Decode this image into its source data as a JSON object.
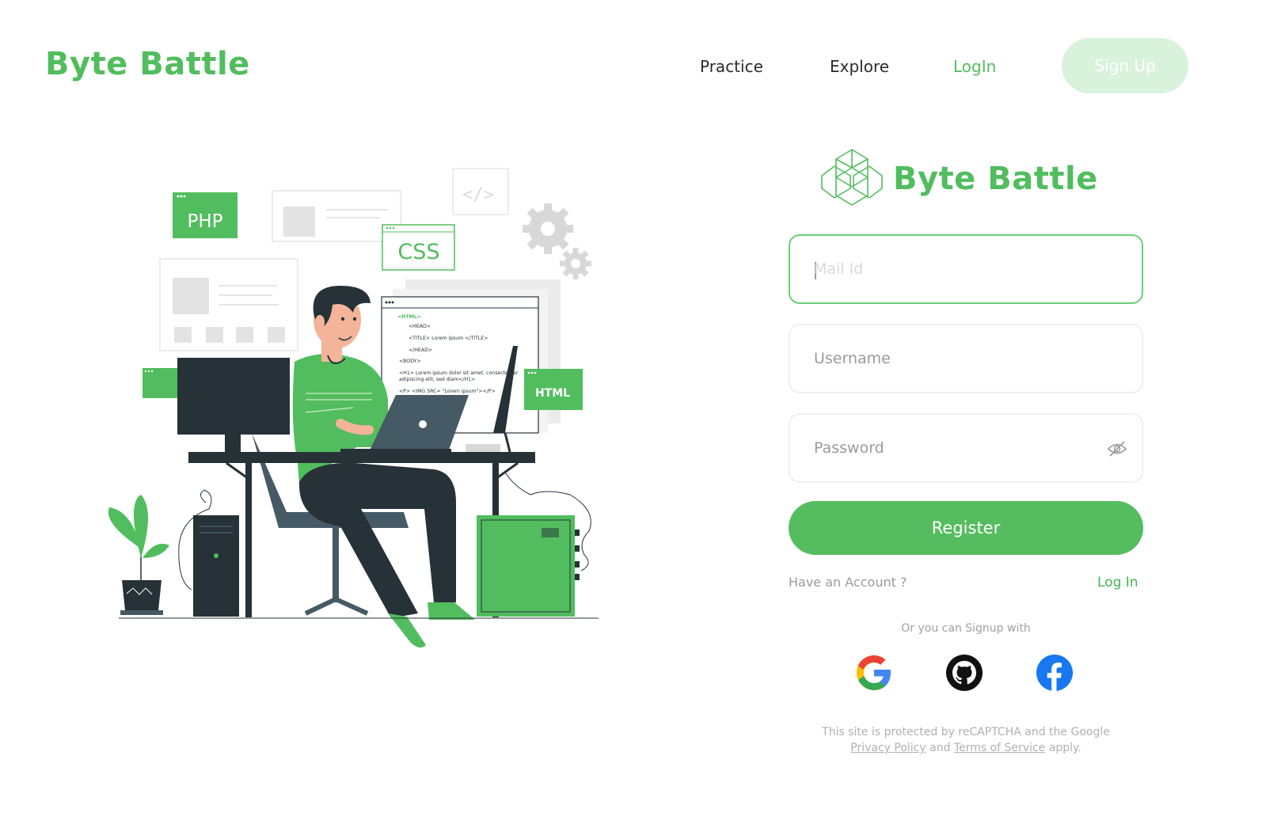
{
  "header": {
    "brand": "Byte Battle",
    "nav": {
      "practice": "Practice",
      "explore": "Explore",
      "login": "LogIn",
      "signup": "Sign Up"
    }
  },
  "illustration": {
    "tags": {
      "php": "PHP",
      "css": "CSS",
      "html": "HTML"
    },
    "code_lines": [
      "<HTML>",
      "<HEAD>",
      "<TITLE> Lorem ipsum </TITLE>",
      "</HEAD>",
      "<BODY>",
      "<H1> Lorem ipsum dolor sit amet, consectetuer",
      "adipiscing elit, sed diam</H1>",
      "<P> <IMG SRC= \"Lorem ipsum\"></P>"
    ]
  },
  "form": {
    "brand": "Byte Battle",
    "mail_placeholder": "Mail Id",
    "username_placeholder": "Username",
    "password_placeholder": "Password",
    "register_label": "Register",
    "have_account": "Have an Account ?",
    "login_link": "Log In",
    "or_signup": "Or you can Signup with",
    "legal": {
      "line1": "This site is protected by reCAPTCHA and the Google",
      "privacy": "Privacy Policy",
      "and": "and",
      "terms": "Terms of Service",
      "apply": "apply."
    }
  },
  "colors": {
    "accent": "#52bd5e",
    "accent_light": "#d9f2dc",
    "dark": "#263238",
    "google_blue": "#4285f4",
    "google_red": "#ea4335",
    "google_yellow": "#fbbc05",
    "google_green": "#34a853",
    "facebook": "#1877f2"
  },
  "icons": {
    "logo": "cube-network-logo",
    "eye": "eye-off-icon",
    "google": "google-icon",
    "github": "github-icon",
    "facebook": "facebook-icon"
  }
}
